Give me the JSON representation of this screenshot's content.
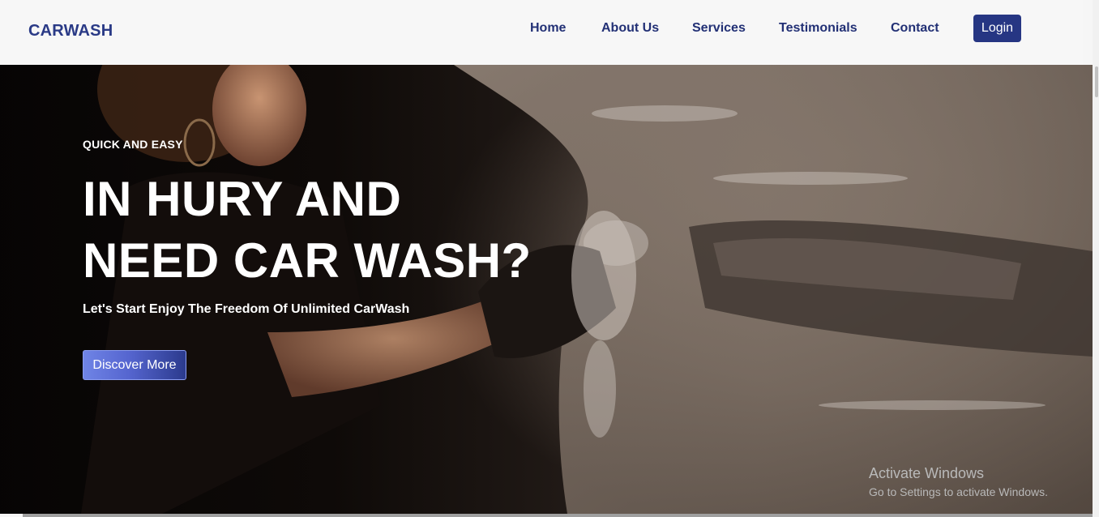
{
  "header": {
    "brand": "CARWASH",
    "nav": {
      "home": "Home",
      "about": "About Us",
      "services": "Services",
      "testimonials": "Testimonials",
      "contact": "Contact"
    },
    "login_label": "Login"
  },
  "hero": {
    "eyebrow": "QUICK AND EASY",
    "headline_line1": "IN HURY AND",
    "headline_line2": "NEED CAR WASH?",
    "subtext": "Let's Start Enjoy The Freedom Of Unlimited CarWash",
    "cta_label": "Discover More"
  },
  "watermark": {
    "title": "Activate Windows",
    "subtitle": "Go to Settings to activate Windows."
  },
  "colors": {
    "brand": "#2a3a86",
    "nav_text": "#223075",
    "login_bg": "#263683",
    "cta_gradient_start": "#6f84e6",
    "cta_gradient_end": "#2b3a8d"
  }
}
